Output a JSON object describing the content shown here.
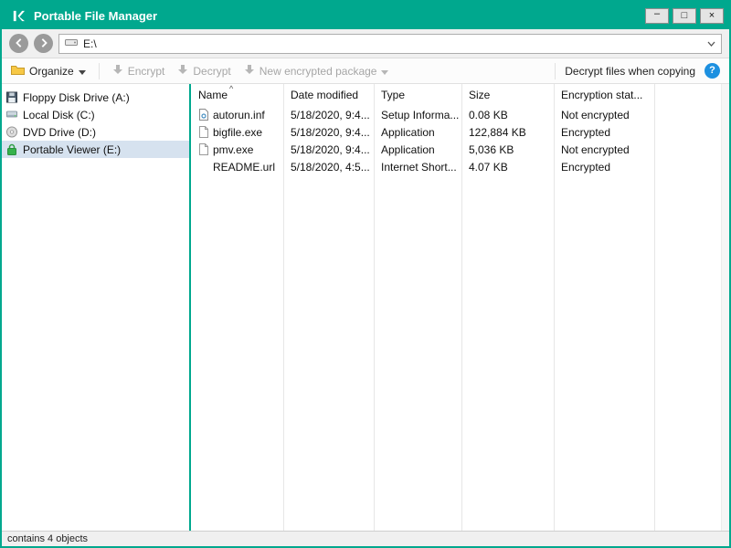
{
  "window": {
    "title": "Portable File Manager",
    "controls": {
      "minimize": "–",
      "maximize": "□",
      "close": "×"
    }
  },
  "colors": {
    "brand": "#00A88E",
    "selection": "#d6e2ef",
    "help_blue": "#1d90e0",
    "disabled_text": "#a6a6a6"
  },
  "icons": {
    "app_logo": "kaspersky-k",
    "back": "arrow-left-circle",
    "forward": "arrow-right-circle",
    "address_drive": "drive-glyph",
    "organize_folder": "yellow-folder",
    "encrypt": "down-arrow",
    "decrypt": "down-arrow",
    "new_package": "down-arrow",
    "help": "?",
    "floppy": "floppy-disk",
    "local_disk": "hard-drive",
    "dvd": "optical-disc",
    "portable": "green-padlock",
    "sort": "^"
  },
  "nav": {
    "address": "E:\\"
  },
  "toolbar": {
    "organize": "Organize",
    "encrypt": "Encrypt",
    "decrypt": "Decrypt",
    "new_package": "New encrypted package",
    "decrypt_when_copying": "Decrypt files when copying",
    "help": "?"
  },
  "sidebar": {
    "items": [
      {
        "label": "Floppy Disk Drive (A:)",
        "icon": "floppy-disk",
        "selected": false
      },
      {
        "label": "Local Disk (C:)",
        "icon": "hard-drive",
        "selected": false
      },
      {
        "label": "DVD Drive (D:)",
        "icon": "optical-disc",
        "selected": false
      },
      {
        "label": "Portable Viewer (E:)",
        "icon": "green-padlock",
        "selected": true
      }
    ]
  },
  "filelist": {
    "sort_indicator": "^",
    "columns": [
      "Name",
      "Date modified",
      "Type",
      "Size",
      "Encryption stat..."
    ],
    "rows": [
      {
        "name": "autorun.inf",
        "date": "5/18/2020, 9:4...",
        "type": "Setup Informa...",
        "size": "0.08 KB",
        "encryption": "Not encrypted",
        "icon": "setup-file"
      },
      {
        "name": "bigfile.exe",
        "date": "5/18/2020, 9:4...",
        "type": "Application",
        "size": "122,884 KB",
        "encryption": "Encrypted",
        "icon": "file"
      },
      {
        "name": "pmv.exe",
        "date": "5/18/2020, 9:4...",
        "type": "Application",
        "size": "5,036 KB",
        "encryption": "Not encrypted",
        "icon": "file"
      },
      {
        "name": "README.url",
        "date": "5/18/2020, 4:5...",
        "type": "Internet Short...",
        "size": "4.07 KB",
        "encryption": "Encrypted",
        "icon": "none"
      }
    ]
  },
  "statusbar": {
    "text": "contains 4 objects"
  }
}
